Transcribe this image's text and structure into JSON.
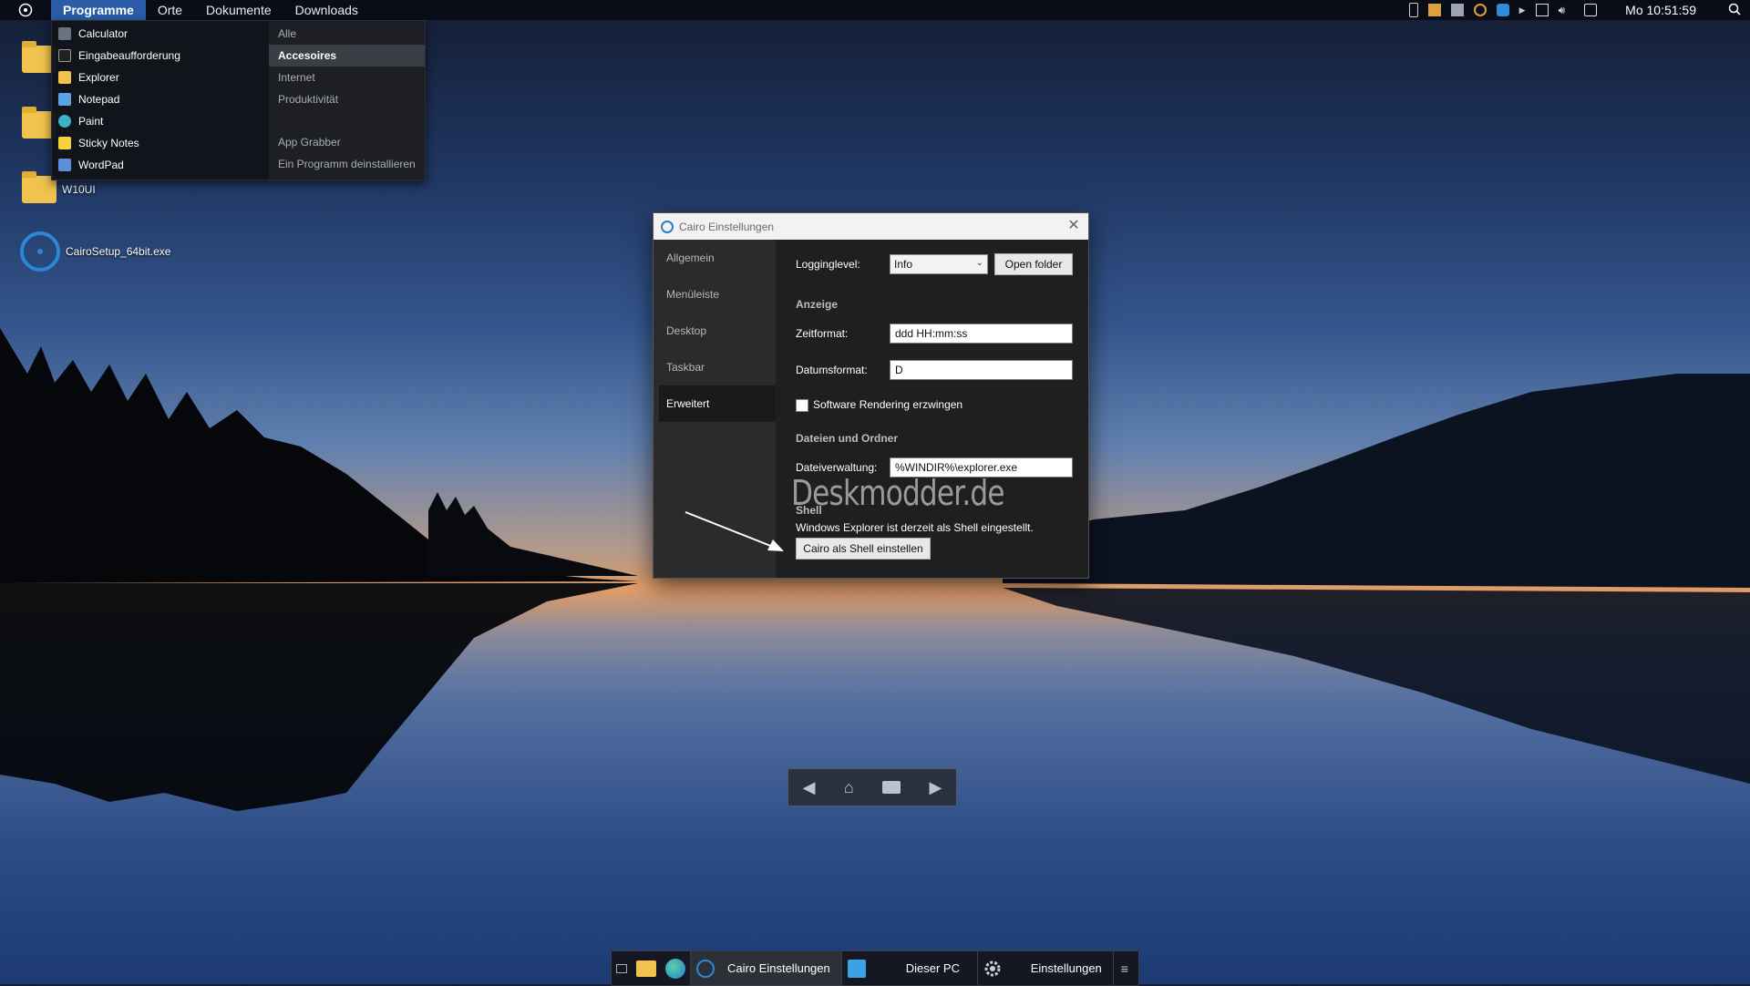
{
  "menubar": {
    "items": [
      "Programme",
      "Orte",
      "Dokumente",
      "Downloads"
    ],
    "clock": "Mo 10:51:59"
  },
  "programs_menu": {
    "apps": [
      "Calculator",
      "Eingabeaufforderung",
      "Explorer",
      "Notepad",
      "Paint",
      "Sticky Notes",
      "WordPad"
    ],
    "categories": [
      "Alle",
      "Accesoires",
      "Internet",
      "Produktivität",
      "App Grabber",
      "Ein Programm deinstallieren"
    ],
    "selected_category": "Accesoires"
  },
  "desktop": {
    "icons": [
      "W10UI",
      "CairoSetup_64bit.exe"
    ]
  },
  "settings_window": {
    "title": "Cairo Einstellungen",
    "nav": [
      "Allgemein",
      "Menüleiste",
      "Desktop",
      "Taskbar",
      "Erweitert"
    ],
    "selected_nav": "Erweitert",
    "logging_label": "Logginglevel:",
    "logging_value": "Info",
    "open_folder": "Open folder",
    "section_anzeige": "Anzeige",
    "time_label": "Zeitformat:",
    "time_value": "ddd HH:mm:ss",
    "date_label": "Datumsformat:",
    "date_value": "D",
    "software_rendering": "Software Rendering erzwingen",
    "section_files": "Dateien und Ordner",
    "filemgr_label": "Dateiverwaltung:",
    "filemgr_value": "%WINDIR%\\explorer.exe",
    "section_shell": "Shell",
    "shell_status": "Windows Explorer ist derzeit als Shell eingestellt.",
    "shell_button": "Cairo als Shell einstellen"
  },
  "watermark": "Deskmodder.de",
  "taskbar": {
    "tasks": [
      "Cairo Einstellungen",
      "Dieser PC",
      "Einstellungen"
    ]
  },
  "colors": {
    "accent": "#2a5ca8",
    "window_bg": "#1f1f1f",
    "folder": "#f0c24e"
  }
}
